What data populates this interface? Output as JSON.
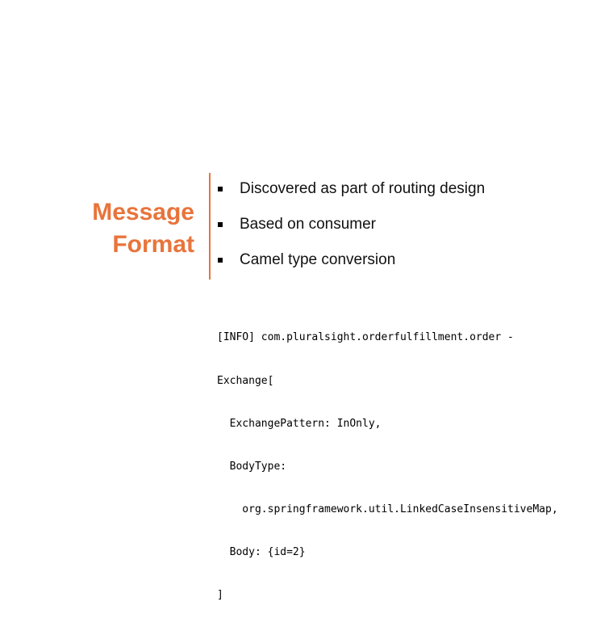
{
  "title": {
    "line1": "Message",
    "line2": "Format"
  },
  "bullets": [
    "Discovered as part of routing design",
    "Based on consumer",
    "Camel type conversion"
  ],
  "log_lines": [
    "[INFO] com.pluralsight.orderfulfillment.order -",
    "Exchange[",
    "  ExchangePattern: InOnly,",
    "  BodyType:",
    "    org.springframework.util.LinkedCaseInsensitiveMap,",
    "  Body: {id=2}",
    "]"
  ],
  "colors": {
    "accent": "#e8743b",
    "text": "#111111",
    "background": "#ffffff"
  }
}
